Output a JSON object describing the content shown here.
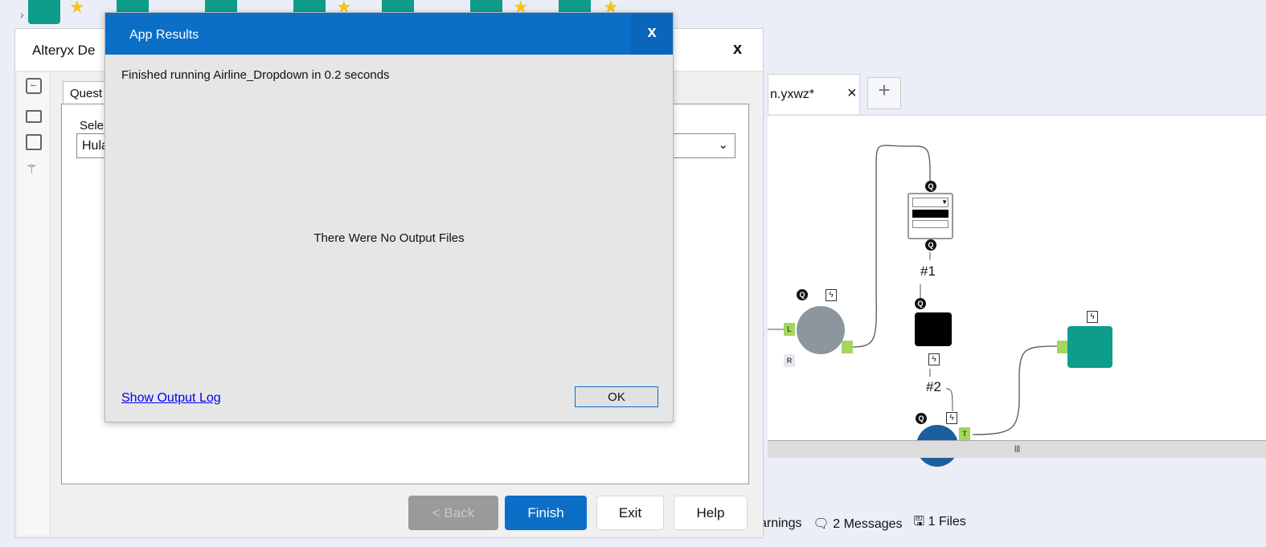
{
  "designer_window": {
    "title": "Alteryx De",
    "close": "x",
    "tab_label": "Quest",
    "select_label": "Sele",
    "select_value": "Hula",
    "buttons": {
      "back": "< Back",
      "finish": "Finish",
      "exit": "Exit",
      "help": "Help"
    }
  },
  "workflow_tab": {
    "label": "n.yxwz*",
    "close": "×",
    "add": "+"
  },
  "canvas": {
    "label_1": "#1",
    "label_2": "#2",
    "scroll_grip": "III"
  },
  "results_bar": {
    "warnings": "arnings",
    "messages": "2 Messages",
    "files": "1 Files"
  },
  "app_results": {
    "title": "App Results",
    "close": "x",
    "message": "Finished running Airline_Dropdown in 0.2 seconds",
    "no_output": "There Were No Output Files",
    "log_link": "Show Output Log",
    "ok": "OK"
  },
  "colors": {
    "accent": "#0b6fc7",
    "teal": "#0e9d8a",
    "anchor": "#a4d65e"
  }
}
